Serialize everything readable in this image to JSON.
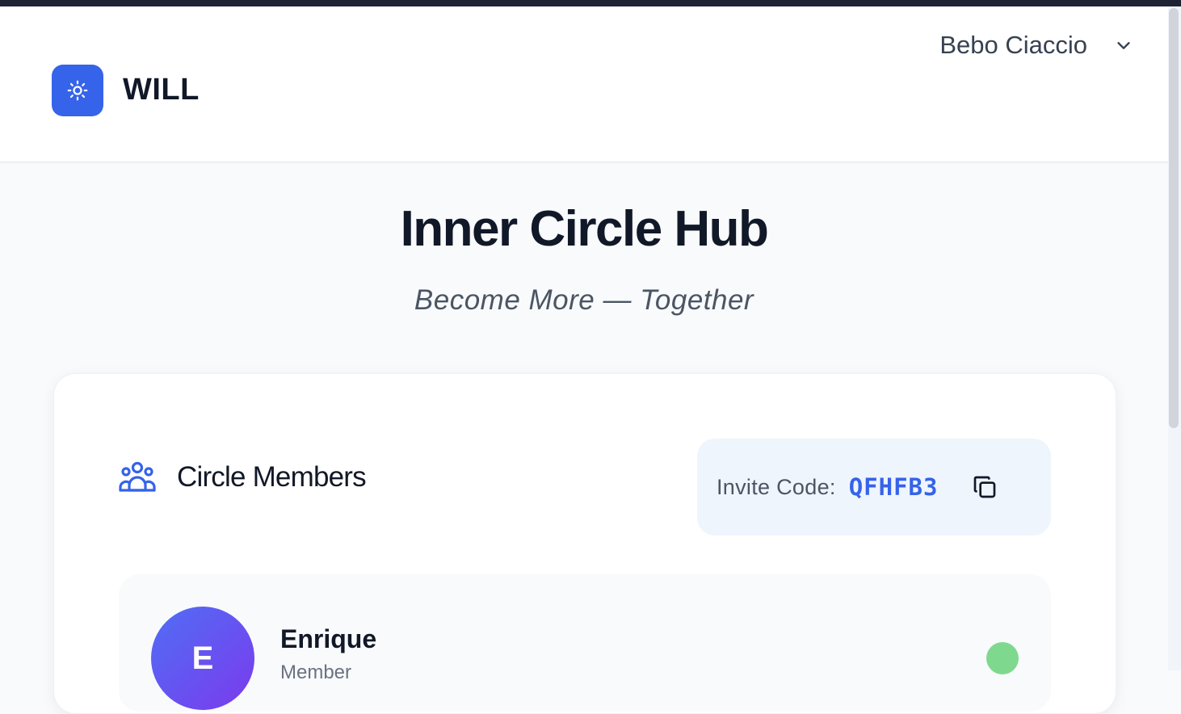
{
  "header": {
    "brand": "WILL",
    "logo_icon": "sun-icon",
    "user_name": "Bebo Ciaccio",
    "user_menu_icon": "chevron-down-icon"
  },
  "page": {
    "title": "Inner Circle Hub",
    "tagline": "Become More — Together"
  },
  "circle": {
    "section_title": "Circle Members",
    "section_icon": "users-group-icon",
    "invite_label": "Invite Code:",
    "invite_code": "QFHFB3",
    "copy_icon": "copy-icon",
    "members": [
      {
        "initial": "E",
        "name": "Enrique",
        "role": "Member",
        "status": "online"
      }
    ]
  },
  "colors": {
    "accent": "#3563e9",
    "header_dark": "#1e2433",
    "status_online": "#7ed98e",
    "invite_bg": "#eff5fd"
  }
}
